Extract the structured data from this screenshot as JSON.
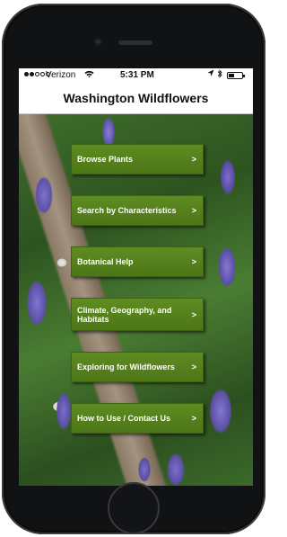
{
  "status_bar": {
    "carrier": "Verizon",
    "time": "5:31 PM"
  },
  "nav": {
    "title": "Washington Wildflowers"
  },
  "menu": {
    "items": [
      {
        "label": "Browse Plants",
        "chevron": ">"
      },
      {
        "label": "Search by Characteristics",
        "chevron": ">"
      },
      {
        "label": "Botanical Help",
        "chevron": ">"
      },
      {
        "label": "Climate, Geography, and Habitats",
        "chevron": ">"
      },
      {
        "label": "Exploring for Wildflowers",
        "chevron": ">"
      },
      {
        "label": "How to Use / Contact Us",
        "chevron": ">"
      }
    ]
  },
  "icons": {
    "wifi": "wifi-icon",
    "location": "location-arrow-icon",
    "bluetooth": "bluetooth-icon",
    "battery": "battery-icon"
  },
  "colors": {
    "button_green": "#5a8620",
    "nav_background": "#ffffff"
  }
}
